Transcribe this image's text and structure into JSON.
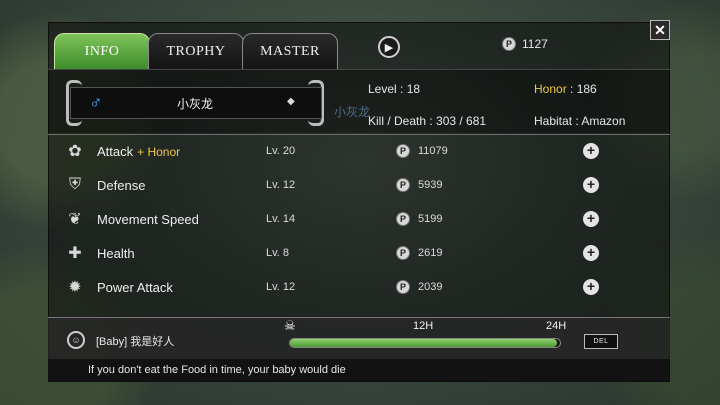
{
  "tabs": [
    {
      "label": "INFO",
      "active": true
    },
    {
      "label": "TROPHY",
      "active": false
    },
    {
      "label": "MASTER",
      "active": false
    }
  ],
  "sound_icon": "speaker-icon",
  "currency": {
    "icon": "P",
    "amount": "1127"
  },
  "close_label": "✕",
  "profile": {
    "gender_icon": "♂",
    "name": "小灰龙",
    "overlay_name": "小灰龙",
    "level_label": "Level : 18",
    "kill_death_label": "Kill / Death : 303 / 681",
    "honor_label": "Honor",
    "honor_value": " : 186",
    "habitat_label": "Habitat : Amazon"
  },
  "skills": [
    {
      "name": "Attack",
      "bonus": "+ Honor",
      "level": "Lv. 20",
      "cost": "11079",
      "icon": "claw-icon"
    },
    {
      "name": "Defense",
      "bonus": "",
      "level": "Lv. 12",
      "cost": "5939",
      "icon": "shield-icon"
    },
    {
      "name": "Movement Speed",
      "bonus": "",
      "level": "Lv. 14",
      "cost": "5199",
      "icon": "feather-icon"
    },
    {
      "name": "Health",
      "bonus": "",
      "level": "Lv. 8",
      "cost": "2619",
      "icon": "health-cross-icon"
    },
    {
      "name": "Power Attack",
      "bonus": "",
      "level": "Lv. 12",
      "cost": "2039",
      "icon": "burst-icon"
    }
  ],
  "coin_symbol": "P",
  "plus_symbol": "+",
  "baby": {
    "name": "[Baby]  我是好人",
    "time_mid": "12H",
    "time_end": "24H",
    "hunger_fraction": 0.99,
    "del_label": "DEL"
  },
  "footer_tip": "If you don't eat the Food in time, your baby would die",
  "colors": {
    "active_tab": "#5aa83a",
    "honor": "#f0c74a",
    "gender": "#4aa8ff",
    "hunger_bar": "#6fb84e"
  }
}
